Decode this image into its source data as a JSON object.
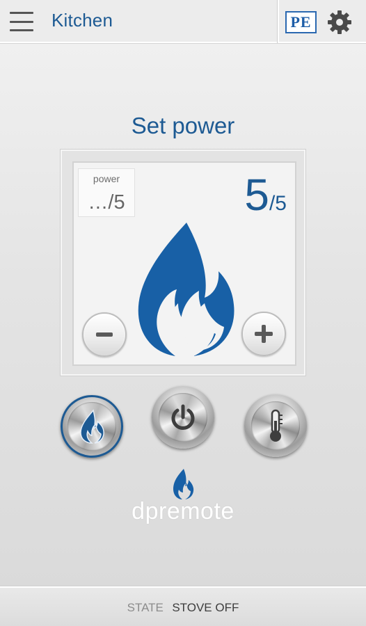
{
  "header": {
    "title": "Kitchen",
    "pe_logo": "PE",
    "menu_icon": "hamburger-menu-icon",
    "settings_icon": "gear-icon"
  },
  "main": {
    "heading": "Set power",
    "power_box": {
      "label": "power",
      "value": "…/5"
    },
    "current_power": {
      "value": "5",
      "max": "/5"
    },
    "controls": {
      "decrease_icon": "minus-icon",
      "increase_icon": "plus-icon"
    },
    "center_icon": "flame-icon"
  },
  "mode_buttons": [
    {
      "icon": "flame-icon",
      "selected": true
    },
    {
      "icon": "power-icon",
      "selected": false
    },
    {
      "icon": "thermometer-icon",
      "selected": false
    }
  ],
  "brand": {
    "name": "dpremote",
    "icon": "flame-logo-icon"
  },
  "status": {
    "label": "STATE",
    "value": "STOVE OFF"
  },
  "colors": {
    "accent": "#1d5a93",
    "flame": "#1860a6",
    "background": "#e4e4e4"
  }
}
